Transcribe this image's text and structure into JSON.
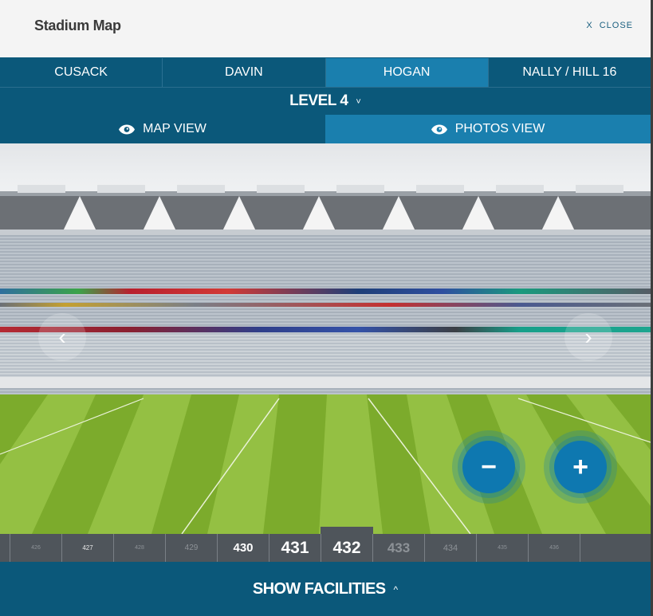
{
  "header": {
    "title": "Stadium Map",
    "close_icon_glyph": "X",
    "close_label": "CLOSE"
  },
  "stands": {
    "tabs": [
      {
        "label": "CUSACK",
        "active": false
      },
      {
        "label": "DAVIN",
        "active": false
      },
      {
        "label": "HOGAN",
        "active": true
      },
      {
        "label": "NALLY / HILL 16",
        "active": false
      }
    ]
  },
  "level": {
    "label": "LEVEL 4",
    "chevron_glyph": "˅"
  },
  "views": [
    {
      "label": "MAP VIEW",
      "icon": "eye-icon",
      "active": false
    },
    {
      "label": "PHOTOS VIEW",
      "icon": "eye-icon",
      "active": true
    }
  ],
  "photo": {
    "description": "View of the pitch and opposite stand from Hogan Level 4",
    "prev_glyph": "‹",
    "next_glyph": "›",
    "zoom_out_glyph": "−",
    "zoom_in_glyph": "+"
  },
  "sections": {
    "items": [
      "426",
      "427",
      "428",
      "429",
      "430",
      "431",
      "432",
      "433",
      "434",
      "435",
      "436"
    ],
    "selected": "432"
  },
  "colors": {
    "primary": "#0b587a",
    "active": "#1a7fae",
    "zoom_button": "#0e78b0",
    "section_strip": "#4f555b"
  },
  "footer": {
    "label": "SHOW FACILITIES",
    "caret_glyph": "^"
  }
}
